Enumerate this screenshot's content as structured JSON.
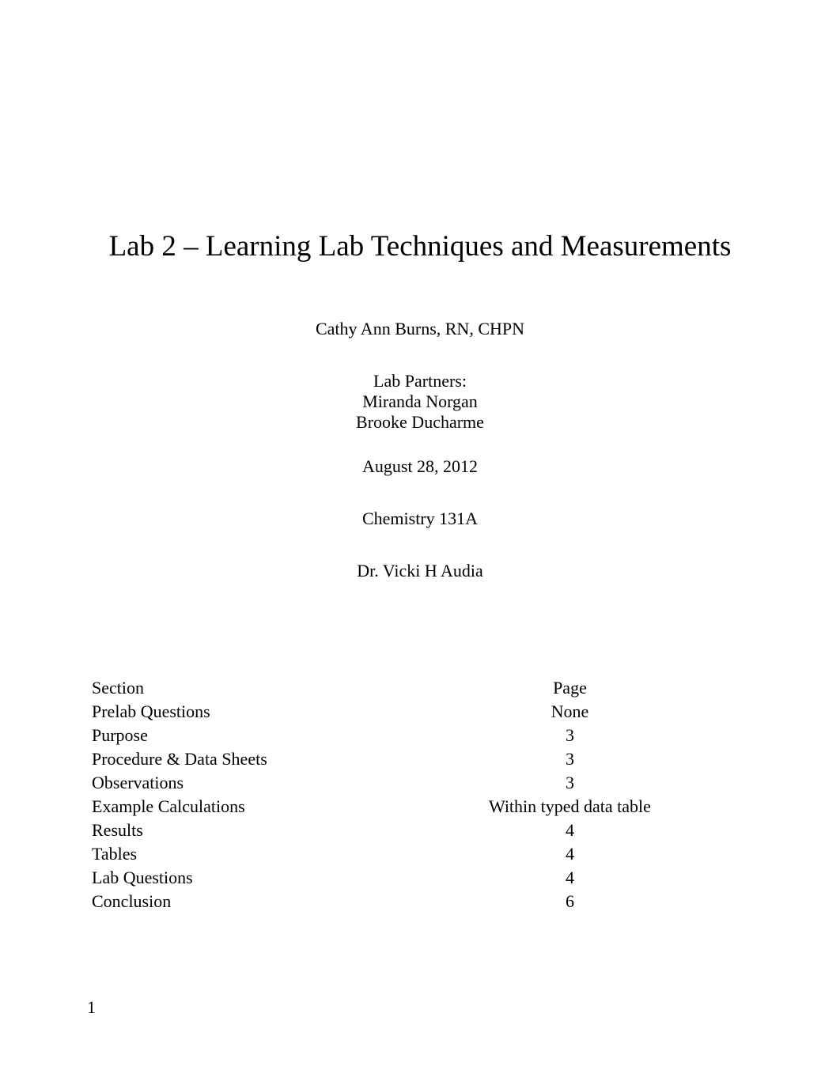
{
  "title": "Lab 2 – Learning Lab Techniques and Measurements",
  "author": "Cathy Ann Burns, RN, CHPN",
  "partners_label": "Lab Partners:",
  "partners": [
    "Miranda Norgan",
    "Brooke Ducharme"
  ],
  "date": "August 28, 2012",
  "course": "Chemistry 131A",
  "instructor": "Dr. Vicki H Audia",
  "toc": {
    "header": {
      "section": "Section",
      "page": "Page"
    },
    "rows": [
      {
        "section": "Prelab Questions",
        "page": "None"
      },
      {
        "section": "Purpose",
        "page": "3"
      },
      {
        "section": "Procedure & Data Sheets",
        "page": "3"
      },
      {
        "section": "Observations",
        "page": "3"
      },
      {
        "section": "Example Calculations",
        "page": "Within typed data table"
      },
      {
        "section": "Results",
        "page": "4"
      },
      {
        "section": "Tables",
        "page": "4"
      },
      {
        "section": "Lab Questions",
        "page": "4"
      },
      {
        "section": "Conclusion",
        "page": "6"
      }
    ]
  },
  "page_number": "1"
}
